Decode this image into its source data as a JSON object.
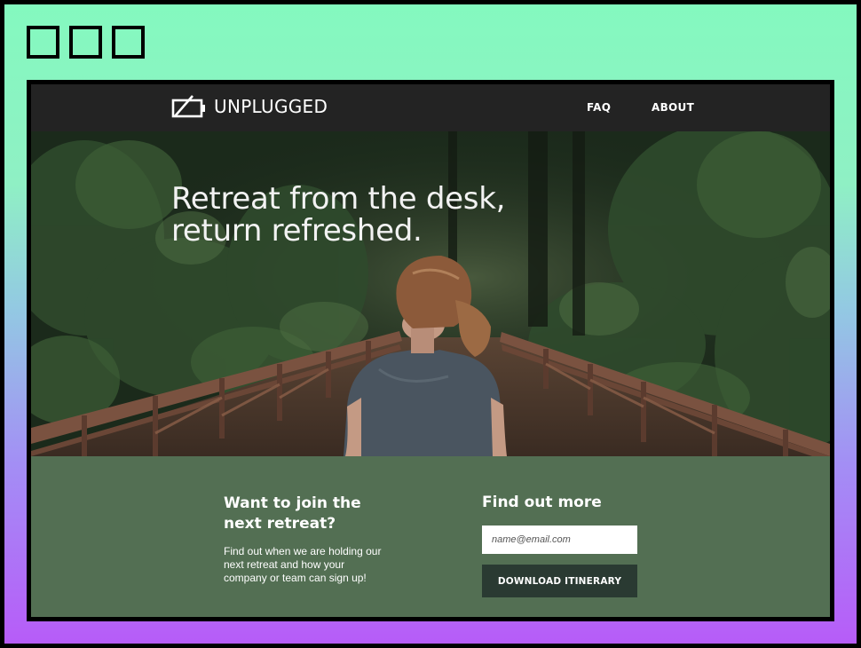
{
  "nav": {
    "logo_text": "UNPLUGGED",
    "links": [
      {
        "label": "FAQ"
      },
      {
        "label": "ABOUT"
      }
    ]
  },
  "hero": {
    "title_line1": "Retreat from the desk,",
    "title_line2": "return refreshed."
  },
  "join": {
    "title_line1": "Want to join the",
    "title_line2": "next retreat?",
    "description": "Find out when we are holding our next retreat and how your company or team can sign up!"
  },
  "signup": {
    "title": "Find out more",
    "email_placeholder": "name@email.com",
    "email_value": "",
    "button_label": "DOWNLOAD ITINERARY"
  },
  "icons": {
    "window_controls": [
      "window-button-icon",
      "window-button-icon",
      "window-button-icon"
    ],
    "logo": "battery-off-icon"
  },
  "colors": {
    "frame_gradient_top": "#84f9bf",
    "frame_gradient_bottom": "#b75cf8",
    "nav_bg": "#232323",
    "signup_bg": "#536f53",
    "button_bg": "#2a3a32"
  }
}
